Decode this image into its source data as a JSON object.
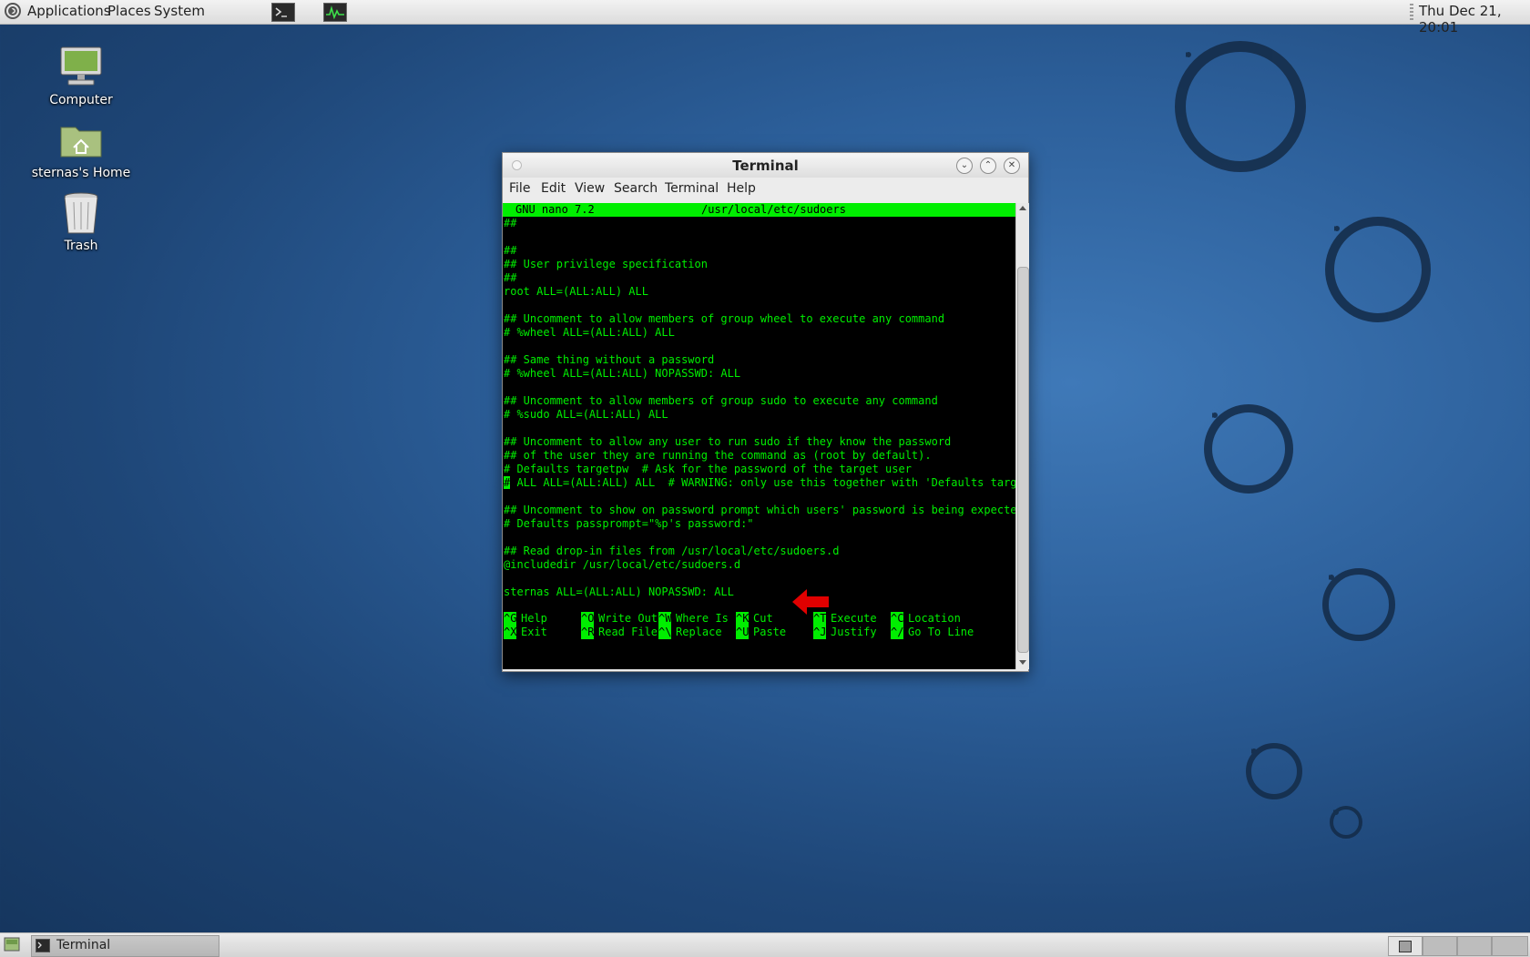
{
  "top_panel": {
    "menus": [
      "Applications",
      "Places",
      "System"
    ],
    "clock": "Thu Dec 21, 20:01"
  },
  "desktop": {
    "icons": [
      {
        "label": "Computer"
      },
      {
        "label": "sternas's Home"
      },
      {
        "label": "Trash"
      }
    ]
  },
  "window": {
    "title": "Terminal",
    "menu": [
      "File",
      "Edit",
      "View",
      "Search",
      "Terminal",
      "Help"
    ]
  },
  "nano": {
    "header_left": "GNU nano 7.2",
    "header_file": "/usr/local/etc/sudoers",
    "lines": [
      "##",
      "",
      "##",
      "## User privilege specification",
      "##",
      "root ALL=(ALL:ALL) ALL",
      "",
      "## Uncomment to allow members of group wheel to execute any command",
      "# %wheel ALL=(ALL:ALL) ALL",
      "",
      "## Same thing without a password",
      "# %wheel ALL=(ALL:ALL) NOPASSWD: ALL",
      "",
      "## Uncomment to allow members of group sudo to execute any command",
      "# %sudo ALL=(ALL:ALL) ALL",
      "",
      "## Uncomment to allow any user to run sudo if they know the password",
      "## of the user they are running the command as (root by default).",
      "# Defaults targetpw  # Ask for the password of the target user",
      "# ALL ALL=(ALL:ALL) ALL  # WARNING: only use this together with 'Defaults targe",
      "",
      "## Uncomment to show on password prompt which users' password is being expected",
      "# Defaults passprompt=\"%p's password:\"",
      "",
      "## Read drop-in files from /usr/local/etc/sudoers.d",
      "@includedir /usr/local/etc/sudoers.d",
      "",
      "sternas ALL=(ALL:ALL) NOPASSWD: ALL"
    ],
    "shortcuts_row1": [
      {
        "key": "^G",
        "label": "Help"
      },
      {
        "key": "^O",
        "label": "Write Out"
      },
      {
        "key": "^W",
        "label": "Where Is"
      },
      {
        "key": "^K",
        "label": "Cut"
      },
      {
        "key": "^T",
        "label": "Execute"
      },
      {
        "key": "^C",
        "label": "Location"
      }
    ],
    "shortcuts_row2": [
      {
        "key": "^X",
        "label": "Exit"
      },
      {
        "key": "^R",
        "label": "Read File"
      },
      {
        "key": "^\\",
        "label": "Replace"
      },
      {
        "key": "^U",
        "label": "Paste"
      },
      {
        "key": "^J",
        "label": "Justify"
      },
      {
        "key": "^/",
        "label": "Go To Line"
      }
    ]
  },
  "annotation": {
    "icon": "red-arrow-left-icon",
    "color": "#e00000"
  },
  "bottom_panel": {
    "task_label": "Terminal"
  }
}
